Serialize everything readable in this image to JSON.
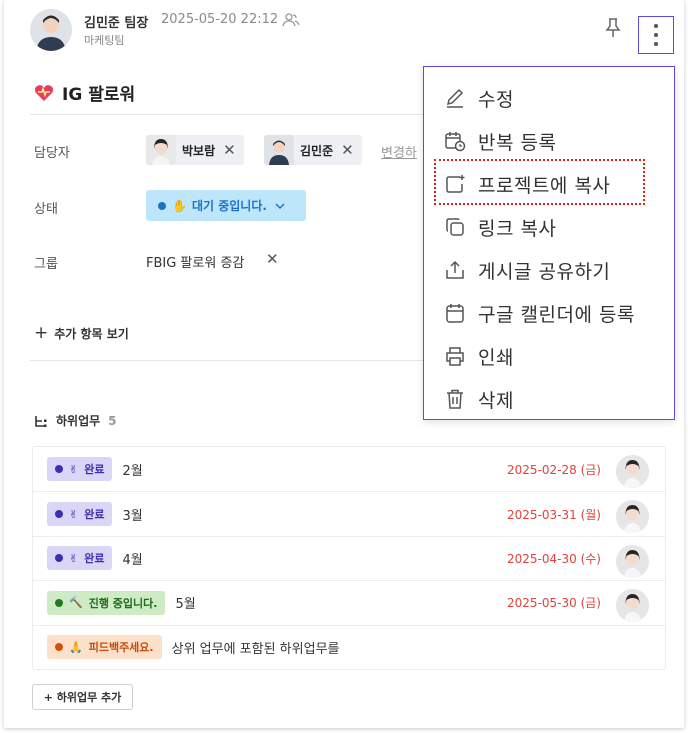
{
  "header": {
    "author": "김민준 팀장",
    "timestamp": "2025-05-20 22:12",
    "department": "마케팅팀"
  },
  "post": {
    "title": "IG 팔로워"
  },
  "fields": {
    "assignee_label": "담당자",
    "assignees": [
      "박보람",
      "김민준"
    ],
    "change_link": "변경하",
    "status_label": "상태",
    "status_value": "대기 중입니다.",
    "status_emoji": "✋",
    "group_label": "그룹",
    "group_value": "FBIG 팔로워 증감",
    "more_fields": "추가 항목 보기"
  },
  "subtasks": {
    "title": "하위업무",
    "count": "5",
    "add_button": "+ 하위업무 추가",
    "rows": [
      {
        "status": "완료",
        "emoji": "✌",
        "name": "2월",
        "due": "2025-02-28 (금)",
        "tag_bg": "#d9d6f6",
        "tag_fg": "#3d2fb0",
        "dot": "#3a2fb5"
      },
      {
        "status": "완료",
        "emoji": "✌",
        "name": "3월",
        "due": "2025-03-31 (월)",
        "tag_bg": "#d9d6f6",
        "tag_fg": "#3d2fb0",
        "dot": "#3a2fb5"
      },
      {
        "status": "완료",
        "emoji": "✌",
        "name": "4월",
        "due": "2025-04-30 (수)",
        "tag_bg": "#d9d6f6",
        "tag_fg": "#3d2fb0",
        "dot": "#3a2fb5"
      },
      {
        "status": "진행 중입니다.",
        "emoji": "🔨",
        "name": "5월",
        "due": "2025-05-30 (금)",
        "tag_bg": "#cdebc4",
        "tag_fg": "#1e6b1a",
        "dot": "#1f7a22"
      },
      {
        "status": "피드백주세요.",
        "emoji": "🙏",
        "name": "상위 업무에 포함된 하위업무를",
        "due": "",
        "tag_bg": "#fde0c9",
        "tag_fg": "#c94a0c",
        "dot": "#d1520f"
      }
    ]
  },
  "menu": {
    "items": [
      {
        "label": "수정",
        "icon": "pencil-icon"
      },
      {
        "label": "반복 등록",
        "icon": "calendar-repeat-icon"
      },
      {
        "label": "프로젝트에 복사",
        "icon": "copy-to-project-icon"
      },
      {
        "label": "링크 복사",
        "icon": "copy-link-icon"
      },
      {
        "label": "게시글 공유하기",
        "icon": "share-icon"
      },
      {
        "label": "구글 캘린더에 등록",
        "icon": "calendar-icon"
      },
      {
        "label": "인쇄",
        "icon": "printer-icon"
      },
      {
        "label": "삭제",
        "icon": "trash-icon"
      }
    ]
  },
  "colors": {
    "accent": "#5b4ce0",
    "status_blue_bg": "#bde6fb",
    "status_blue_fg": "#1b73c8",
    "due_red": "#e0433b",
    "highlight_red": "#d9241c"
  }
}
